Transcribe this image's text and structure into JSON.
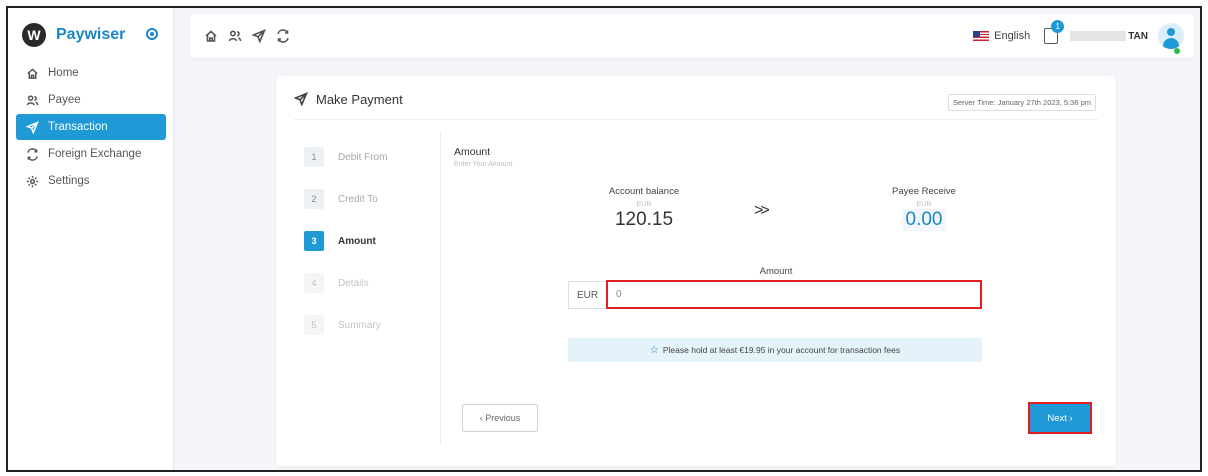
{
  "app": {
    "name": "Paywiser",
    "logo_letter": "W",
    "accent": "#1f9ad6",
    "highlight": "#e01f25"
  },
  "sidebar": {
    "items": [
      {
        "label": "Home",
        "icon": "home-icon",
        "active": false
      },
      {
        "label": "Payee",
        "icon": "users-icon",
        "active": false
      },
      {
        "label": "Transaction",
        "icon": "send-icon",
        "active": true
      },
      {
        "label": "Foreign Exchange",
        "icon": "exchange-icon",
        "active": false
      },
      {
        "label": "Settings",
        "icon": "gear-icon",
        "active": false
      }
    ]
  },
  "topbar": {
    "icons": [
      "home-icon",
      "users-icon",
      "send-icon",
      "exchange-icon"
    ],
    "language": "English",
    "notification_count": "1",
    "username": "TAN"
  },
  "page": {
    "title": "Make Payment",
    "server_time": "Server Time: January 27th 2023, 5:36 pm"
  },
  "steps": [
    {
      "num": "1",
      "label": "Debit From"
    },
    {
      "num": "2",
      "label": "Credit To"
    },
    {
      "num": "3",
      "label": "Amount"
    },
    {
      "num": "4",
      "label": "Details"
    },
    {
      "num": "5",
      "label": "Summary"
    }
  ],
  "amount_section": {
    "title": "Amount",
    "subtitle": "Enter Your Amount",
    "account_balance_label": "Account balance",
    "account_balance_currency": "EUR",
    "account_balance_value": "120.15",
    "arrow": ">>",
    "payee_receive_label": "Payee Receive",
    "payee_receive_currency": "EUR",
    "payee_receive_value": "0.00",
    "amount_label": "Amount",
    "currency_prefix": "EUR",
    "amount_value": "0",
    "notice": "Please hold at least €19.95 in your account for transaction fees"
  },
  "buttons": {
    "previous": "‹  Previous",
    "next": "Next  ›"
  }
}
